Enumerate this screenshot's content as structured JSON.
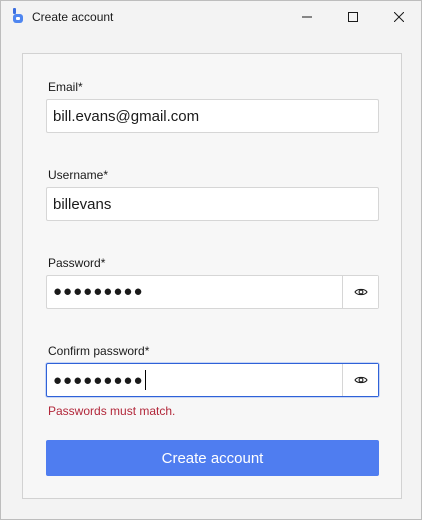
{
  "window": {
    "title": "Create account"
  },
  "form": {
    "email": {
      "label": "Email*",
      "value": "bill.evans@gmail.com"
    },
    "username": {
      "label": "Username*",
      "value": "billevans"
    },
    "password": {
      "label": "Password*",
      "value": "●●●●●●●●●"
    },
    "confirm_password": {
      "label": "Confirm password*",
      "value": "●●●●●●●●●"
    },
    "error_message": "Passwords must match.",
    "submit_label": "Create account"
  },
  "colors": {
    "accent": "#4f7df0",
    "focus_border": "#2f62d8",
    "error": "#b2273a"
  },
  "icons": {
    "app": "app-logo-icon",
    "show_password": "eye-icon"
  }
}
